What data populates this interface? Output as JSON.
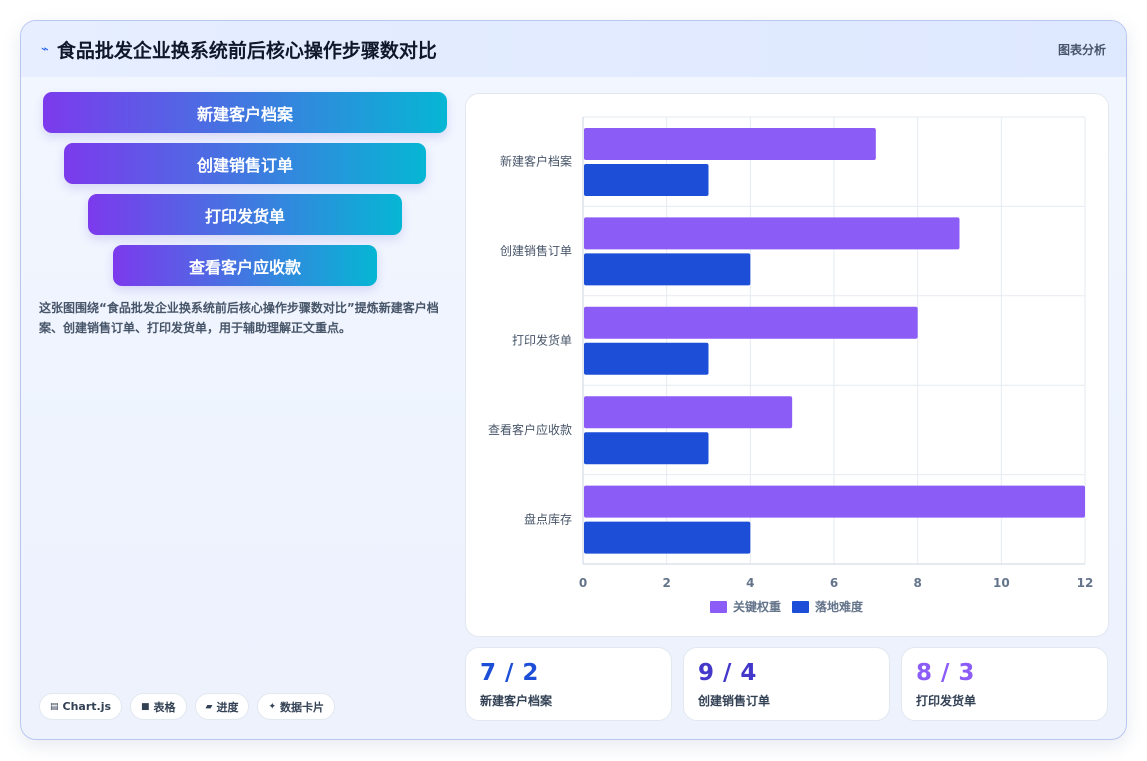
{
  "header": {
    "icon": "sparkline-icon",
    "title": "食品批发企业换系统前后核心操作步骤数对比",
    "tag": "图表分析"
  },
  "funnel": [
    {
      "label": "新建客户档案"
    },
    {
      "label": "创建销售订单"
    },
    {
      "label": "打印发货单"
    },
    {
      "label": "查看客户应收款"
    }
  ],
  "summary": "这张图围绕“食品批发企业换系统前后核心操作步骤数对比”提炼新建客户档案、创建销售订单、打印发货单，用于辅助理解正文重点。",
  "chips": [
    {
      "icon": "chart-icon",
      "label": "Chart.js"
    },
    {
      "icon": "table-icon",
      "label": "表格"
    },
    {
      "icon": "progress-icon",
      "label": "进度"
    },
    {
      "icon": "sparkle-icon",
      "label": "数据卡片"
    }
  ],
  "stats": [
    {
      "value": "7 / 2",
      "label": "新建客户档案",
      "color": "#1d4ed8"
    },
    {
      "value": "9 / 4",
      "label": "创建销售订单",
      "color": "#4338ca"
    },
    {
      "value": "8 / 3",
      "label": "打印发货单",
      "color": "#8b5cf6"
    }
  ],
  "chart_data": {
    "type": "bar",
    "orientation": "horizontal",
    "categories": [
      "新建客户档案",
      "创建销售订单",
      "打印发货单",
      "查看客户应收款",
      "盘点库存"
    ],
    "series": [
      {
        "name": "关键权重",
        "values": [
          7,
          9,
          8,
          5,
          12
        ],
        "color": "#8b5cf6"
      },
      {
        "name": "落地难度",
        "values": [
          3,
          4,
          3,
          3,
          4
        ],
        "color": "#1d4ed8"
      }
    ],
    "xlim": [
      0,
      12
    ],
    "xticks": [
      "0",
      "2",
      "4",
      "6",
      "8",
      "10",
      "12"
    ],
    "grid": true,
    "legend": "bottom"
  }
}
